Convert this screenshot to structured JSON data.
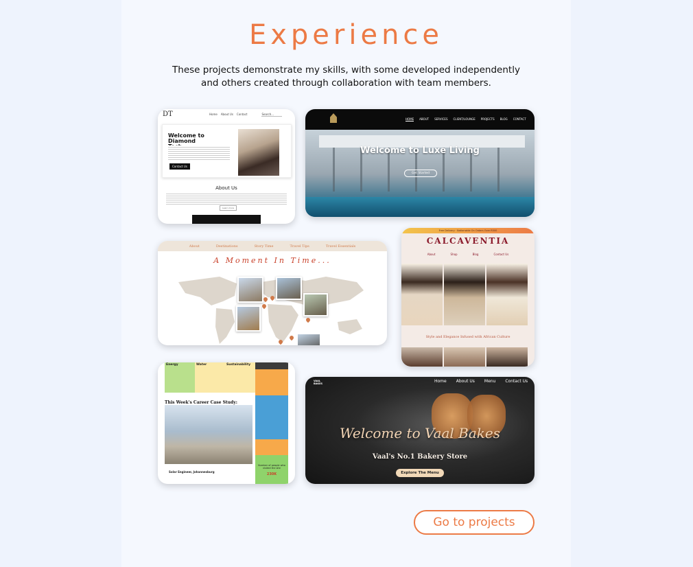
{
  "section": {
    "title": "Experience",
    "subtitle": "These projects demonstrate my skills, with some developed independently and others created through collaboration with team members.",
    "cta_label": "Go to projects"
  },
  "projects": {
    "diamond_tech": {
      "logo": "DT",
      "nav": [
        "Home",
        "About Us",
        "Contact",
        "Search..."
      ],
      "hero_title": "Welcome to Diamond Tech",
      "hero_button": "Contact Us",
      "about_title": "About Us",
      "learn_more": "Learn more"
    },
    "luxe_living": {
      "nav": [
        "HOME",
        "ABOUT",
        "SERVICES",
        "CLIENT/LOUNGE",
        "PROJECTS",
        "BLOG",
        "CONTACT"
      ],
      "hero_title": "Welcome to Luxe Living",
      "hero_button": "Get Started"
    },
    "travel": {
      "nav": [
        "About",
        "Destinations",
        "Story Time",
        "Travel Tips",
        "Travel Essentials"
      ],
      "hero_title": "A Moment In Time..."
    },
    "calcaventia": {
      "banner": "Free Delivery · Nationwide On Orders Over R500",
      "brand": "CALCAVENTIA",
      "nav": [
        "About",
        "Shop",
        "Blog",
        "Contact Us"
      ],
      "tagline": "Style and Elegance Infused with African Culture"
    },
    "career": {
      "columns": [
        "Energy",
        "Water",
        "Sustainability"
      ],
      "case_study_title": "This Week's Career Case Study:",
      "case_study_name": "Solar Engineer, Johannesburg",
      "stat_label": "Number of people who visited the site",
      "stat_value": "230K"
    },
    "vaal_bakes": {
      "logo": "VAAL BAKES",
      "nav": [
        "Home",
        "About Us",
        "Menu",
        "Contact Us"
      ],
      "hero_title": "Welcome to Vaal Bakes",
      "hero_sub": "Vaal's No.1 Bakery Store",
      "hero_button": "Explore The Menu"
    }
  },
  "colors": {
    "accent": "#ec7a45",
    "page_bg": "#f5f8fe",
    "outer_bg": "#eef3fd"
  }
}
